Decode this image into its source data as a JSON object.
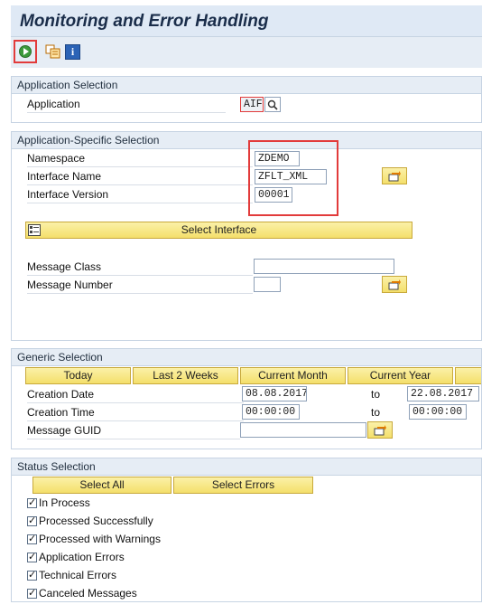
{
  "title": "Monitoring and Error Handling",
  "toolbar": {
    "execute": "execute-icon",
    "variant": "variant-icon",
    "info": "i"
  },
  "app_selection": {
    "header": "Application Selection",
    "application_label": "Application",
    "application_value": "AIF"
  },
  "app_specific": {
    "header": "Application-Specific Selection",
    "namespace_label": "Namespace",
    "namespace_value": "ZDEMO",
    "interface_name_label": "Interface Name",
    "interface_name_value": "ZFLT_XML",
    "interface_version_label": "Interface Version",
    "interface_version_value": "00001",
    "select_interface": "Select Interface",
    "message_class_label": "Message Class",
    "message_class_value": "",
    "message_number_label": "Message Number",
    "message_number_value": ""
  },
  "generic": {
    "header": "Generic Selection",
    "buttons": [
      "Today",
      "Last 2 Weeks",
      "Current Month",
      "Current Year"
    ],
    "creation_date_label": "Creation Date",
    "creation_date_from": "08.08.2017",
    "creation_date_to": "22.08.2017",
    "creation_time_label": "Creation Time",
    "creation_time_from": "00:00:00",
    "creation_time_to": "00:00:00",
    "to_label": "to",
    "message_guid_label": "Message GUID",
    "message_guid_value": ""
  },
  "status": {
    "header": "Status Selection",
    "select_all": "Select All",
    "select_errors": "Select Errors",
    "options": [
      "In Process",
      "Processed Successfully",
      "Processed with Warnings",
      "Application Errors",
      "Technical Errors",
      "Canceled Messages"
    ]
  },
  "colors": {
    "accent_red": "#e23b3b",
    "button_yellow": "#f4df6b",
    "panel_blue": "#e6edf5"
  }
}
